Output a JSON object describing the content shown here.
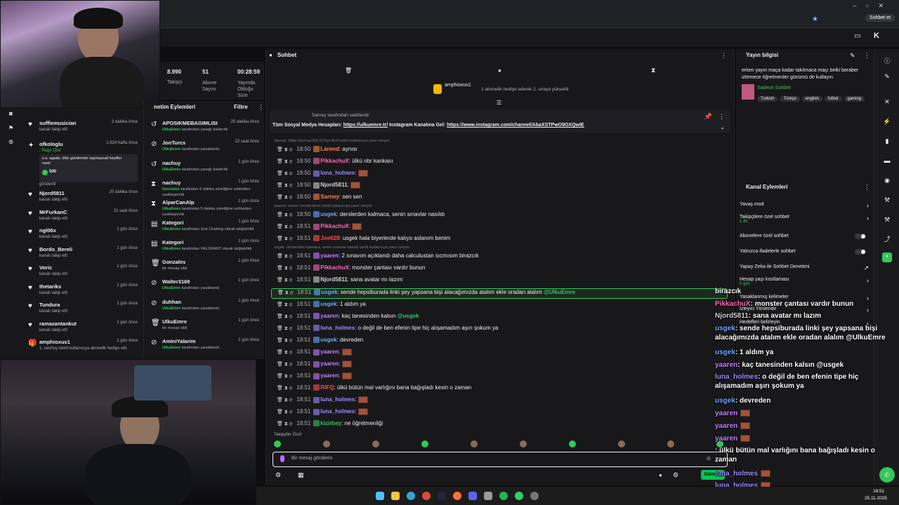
{
  "browser": {
    "profile_label": "Sohbet et"
  },
  "stats": [
    {
      "value": "8.990",
      "label": "Takipçi"
    },
    {
      "value": "51",
      "label": "Abone Sayısı"
    },
    {
      "value": "00:28:59",
      "label": "Yayında Olduğu Süre"
    }
  ],
  "feed": {
    "items": [
      {
        "name": "sufflemusician",
        "sub": "kanalı takip etti",
        "time": "3 dakika önce",
        "icon": "heart-icon"
      },
      {
        "name": "ofkologlu",
        "sub": ", Rage Quit",
        "time": "1.924 hafta önce",
        "icon": "crown-icon"
      },
      {
        "name": "s.a. agalar, ülke gündemini saymazsak keyifler nasıl",
        "sub": "500",
        "time": "",
        "icon": ""
      },
      {
        "name": "Njord5811",
        "sub": "kanalı takip etti",
        "time": "20 dakika önce",
        "icon": "heart-icon"
      },
      {
        "name": "MrFurkanC",
        "sub": "kanalı takip etti",
        "time": "21 saat önce",
        "icon": "heart-icon"
      },
      {
        "name": "ngl06x",
        "sub": "kanalı takip etti",
        "time": "1 gün önce",
        "icon": "heart-icon"
      },
      {
        "name": "Bordo_Bereli",
        "sub": "kanalı takip etti",
        "time": "1 gün önce",
        "icon": "heart-icon"
      },
      {
        "name": "Voric",
        "sub": "kanalı takip etti",
        "time": "1 gün önce",
        "icon": "heart-icon"
      },
      {
        "name": "thetariks",
        "sub": "kanalı takip etti",
        "time": "1 gün önce",
        "icon": "heart-icon"
      },
      {
        "name": "Tundura",
        "sub": "kanalı takip etti",
        "time": "1 gün önce",
        "icon": "heart-icon"
      },
      {
        "name": "ramazantankut",
        "sub": "kanalı takip etti",
        "time": "1 gün önce",
        "icon": "heart-icon"
      },
      {
        "name": "amphioxus1",
        "sub": "1, nachuy isimli kullanıcıya abonelik hediye etti.",
        "time": "1 gün önce",
        "icon": "gift-icon"
      }
    ],
    "gift_sent": "gönderdi"
  },
  "mod": {
    "title": "netim Eylemleri",
    "filter": "Filtre",
    "items": [
      {
        "name": "APOSIKMEBAGIMLISI",
        "actor": "UlkuEmre",
        "sub": "tarafından yasağı kaldırıldı",
        "time": "25 dakika önce",
        "icon": "unban-icon"
      },
      {
        "name": "JonTurcs",
        "actor": "UlkuEmre",
        "sub": "tarafından yasaklandı",
        "time": "22 saat önce",
        "icon": "ban-icon"
      },
      {
        "name": "nachuy",
        "actor": "UlkuEmre",
        "sub": "tarafından yasağı kaldırıldı",
        "time": "1 gün önce",
        "icon": "unban-icon"
      },
      {
        "name": "nachuy",
        "actor": "Gonzales",
        "sub": "tarafından 5 dakika süreliğine sohbetten uzaklaştırıldı",
        "time": "1 gün önce",
        "icon": "timeout-icon"
      },
      {
        "name": "AlparCanAlp",
        "actor": "UlkuEmre",
        "sub": "tarafından 5 dakika süreliğine sohbetten uzaklaştırıldı",
        "time": "1 gün önce",
        "icon": "timeout-icon"
      },
      {
        "name": "Kategori",
        "actor": "UlkuEmre",
        "sub": "tarafından Just Chatting olarak değiştirildi",
        "time": "1 gün önce",
        "icon": "category-icon"
      },
      {
        "name": "Kategori",
        "actor": "UlkuEmre",
        "sub": "tarafından VALORANT olarak değiştirildi",
        "time": "1 gün önce",
        "icon": "category-icon"
      },
      {
        "name": "Gonzales",
        "actor": "",
        "sub": "bir mesajı sildi",
        "time": "1 gün önce",
        "icon": "trash-icon"
      },
      {
        "name": "Walter3169",
        "actor": "UlkuEmre",
        "sub": "tarafından yasaklandı",
        "time": "1 gün önce",
        "icon": "ban-icon"
      },
      {
        "name": "duhhan",
        "actor": "UlkuEmre",
        "sub": "tarafından yasaklandı",
        "time": "1 gün önce",
        "icon": "ban-icon"
      },
      {
        "name": "UlkuEmre",
        "actor": "",
        "sub": "bir mesajı sildi",
        "time": "1 gün önce",
        "icon": "trash-icon"
      },
      {
        "name": "AminiYalarim",
        "actor": "UlkuEmre",
        "sub": "tarafından yasaklandı",
        "time": "1 gün önce",
        "icon": "ban-icon"
      }
    ]
  },
  "chat": {
    "title": "Sohbet",
    "gift_user": "amphioxus1",
    "gift_text": "1 abonelik hediye ederek 2. sıraya yükseldi",
    "pinned_by": "Sarney tarafından sabitlendi",
    "pinned_text": "Tüm Sosyal Medya Hesapları: ",
    "pinned_link1": "https://ulkuemre.tr/",
    "pinned_mid": " Instagram Kanalına Gel: ",
    "pinned_link2": "https://www.instagram.com/channel/AbaXSTPwO9OXQwIE",
    "reply1": "Sarney: https://syrt.ac/rQLX2/3yz-Bc4 isimli kullanıcıya yanıt veriyor",
    "reply2": "yaaren: ooooo nerelerdesin isimli kullanıcıya yanıt veriyor",
    "reply3": "usgek: derslerden kalmaca, senin sınavlar nasıldı isimli kullanıcıya yanıt veriyor",
    "messages": [
      {
        "time": "18:50",
        "user": "Larend",
        "color": "#ff7f50",
        "text": "aynısı",
        "emote": false
      },
      {
        "time": "18:50",
        "user": "PikkachuX",
        "color": "#ff69b4",
        "text": "ülkü nbr kankası",
        "emote": false
      },
      {
        "time": "18:50",
        "user": "luna_holmes",
        "color": "#9b8cff",
        "text": "",
        "emote": true
      },
      {
        "time": "18:50",
        "user": "Njord5811",
        "color": "#d0d0d0",
        "text": "",
        "emote": true
      },
      {
        "time": "18:50",
        "user": "Sarney",
        "color": "#ff7f50",
        "text": "sen sen",
        "emote": false
      },
      {
        "time": "18:50",
        "user": "usgek",
        "color": "#6aa9ff",
        "text": "derslerden kalmaca, senin sınavlar nasıldı",
        "emote": false
      },
      {
        "time": "18:51",
        "user": "PikkachuX",
        "color": "#ff69b4",
        "text": "",
        "emote": true
      },
      {
        "time": "18:51",
        "user": "Joe628",
        "color": "#ff4d4d",
        "text": "usgek hala biyerlerde kalıyo aslanım benim",
        "emote": false
      },
      {
        "time": "18:51",
        "user": "yaaren",
        "color": "#c77dff",
        "text": "2 sınavım açıklandı daha calculustan sıcmısım birazcık",
        "emote": false
      },
      {
        "time": "18:51",
        "user": "PikkachuX",
        "color": "#ff69b4",
        "text": "monster çantası vardır bunun",
        "emote": false
      },
      {
        "time": "18:51",
        "user": "Njord5811",
        "color": "#d0d0d0",
        "text": "sana avatar mı lazım",
        "emote": false
      },
      {
        "time": "18:51",
        "user": "usgek",
        "color": "#6aa9ff",
        "text": "sende hepsiburada linki şey yapsana bişi alacağımızda atalım ekle oradan alalım ",
        "mention": "@UlkuEmre",
        "emote": false
      },
      {
        "time": "18:51",
        "user": "usgek",
        "color": "#6aa9ff",
        "text": "1 aldım ya",
        "emote": false
      },
      {
        "time": "18:51",
        "user": "yaaren",
        "color": "#c77dff",
        "text": "kaç tanesinden kalsın ",
        "mention": "@usgek",
        "emote": false
      },
      {
        "time": "18:51",
        "user": "luna_holmes",
        "color": "#9b8cff",
        "text": "o değil de ben efenin tipe hiç alışamadım aşırı şokum ya",
        "emote": false
      },
      {
        "time": "18:51",
        "user": "usgek",
        "color": "#6aa9ff",
        "text": "devreden",
        "emote": false
      },
      {
        "time": "18:51",
        "user": "yaaren",
        "color": "#c77dff",
        "text": "",
        "emote": true
      },
      {
        "time": "18:51",
        "user": "yaaren",
        "color": "#c77dff",
        "text": "",
        "emote": true
      },
      {
        "time": "18:51",
        "user": "yaaren",
        "color": "#c77dff",
        "text": "",
        "emote": true
      },
      {
        "time": "18:51",
        "user": "RIFQ",
        "color": "#ff4d4d",
        "text": "ülkü bütün mal varlığını bana bağışladı kesin o zaman",
        "emote": false
      },
      {
        "time": "18:51",
        "user": "luna_holmes",
        "color": "#9b8cff",
        "text": "",
        "emote": true
      },
      {
        "time": "18:51",
        "user": "luna_holmes",
        "color": "#9b8cff",
        "text": "",
        "emote": true
      },
      {
        "time": "18:51",
        "user": "kizirbey",
        "color": "#34c759",
        "text": "ne öğretmenliği",
        "emote": false
      }
    ],
    "followers_only": "Takipçiler Özel",
    "input_placeholder": "Bir mesaj gönderin",
    "send": "Gönder"
  },
  "stream_info": {
    "title": "Yayın bilgisi",
    "desc": "erken yayın maça kadar takılmaca maçı belki beraber izlemece öğretmenler günümü de kutlayın",
    "category": "Sadece Sohbet",
    "tags": [
      "Turkish",
      "Türkçe",
      "english",
      "futbol",
      "gaming"
    ]
  },
  "channel_actions": {
    "title": "Kanal Eylemleri",
    "items": [
      {
        "label": "Yavaş mod",
        "sub": "",
        "type": "chevron"
      },
      {
        "label": "Takipçilere özel sohbet",
        "sub": "1 dk.",
        "type": "chevron"
      },
      {
        "label": "Abonelere özel sohbet",
        "sub": "",
        "type": "toggle"
      },
      {
        "label": "Yalnızca ifadelerle sohbet",
        "sub": "",
        "type": "toggle"
      },
      {
        "label": "Yapay Zeka ile Sohbet Denetimi",
        "sub": "",
        "type": "link"
      },
      {
        "label": "Hesap yaşı kısıtlaması",
        "sub": "5 gün",
        "type": "chevron"
      },
      {
        "label": "Yasaklanmış kelimeler",
        "sub": "",
        "type": "chevron"
      },
      {
        "label": "İzleyici Yönlendir",
        "sub": "",
        "type": "chevron"
      },
      {
        "label": "Hedefleri belirleyin",
        "sub": "",
        "type": "chevron"
      }
    ]
  },
  "overlay": [
    {
      "user": "",
      "text": "birazcık",
      "color": "#ffffff"
    },
    {
      "user": "PikkachuX",
      "text": ": monster çantası vardır bunun",
      "color": "#ff69b4"
    },
    {
      "user": "Njord5811",
      "text": ": sana avatar mı lazım",
      "color": "#d0d0d0"
    },
    {
      "user": "usgek",
      "text": ": sende hepsiburada linki şey yapsana bişi alacağımızda atalım ekle oradan alalım @UlkuEmre",
      "color": "#6aa9ff"
    },
    {
      "user": "usgek",
      "text": ": 1 aldım ya",
      "color": "#6aa9ff"
    },
    {
      "user": "yaaren",
      "text": ": kaç tanesinden kalsın @usgek",
      "color": "#c77dff"
    },
    {
      "user": "luna_holmes",
      "text": ": o değil de ben efenin tipe hiç alışamadım aşırı şokum ya",
      "color": "#9b8cff"
    },
    {
      "user": "usgek",
      "text": ": devreden",
      "color": "#6aa9ff"
    },
    {
      "user": "yaaren",
      "text": "",
      "color": "#c77dff"
    },
    {
      "user": "yaaren",
      "text": "",
      "color": "#c77dff"
    },
    {
      "user": "yaaren",
      "text": "",
      "color": "#c77dff"
    },
    {
      "user": "",
      "text": ": ülkü bütün mal varlığını bana bağışladı kesin o zaman",
      "color": "#ff4d4d"
    },
    {
      "user": "luna_holmes",
      "text": "",
      "color": "#9b8cff"
    },
    {
      "user": "luna_holmes",
      "text": "",
      "color": "#9b8cff"
    },
    {
      "user": "kizirbey",
      "text": ": ne öğretmenliği",
      "color": "#34c759"
    }
  ],
  "taskbar": {
    "time": "18:51",
    "date": "25.11.2025"
  }
}
